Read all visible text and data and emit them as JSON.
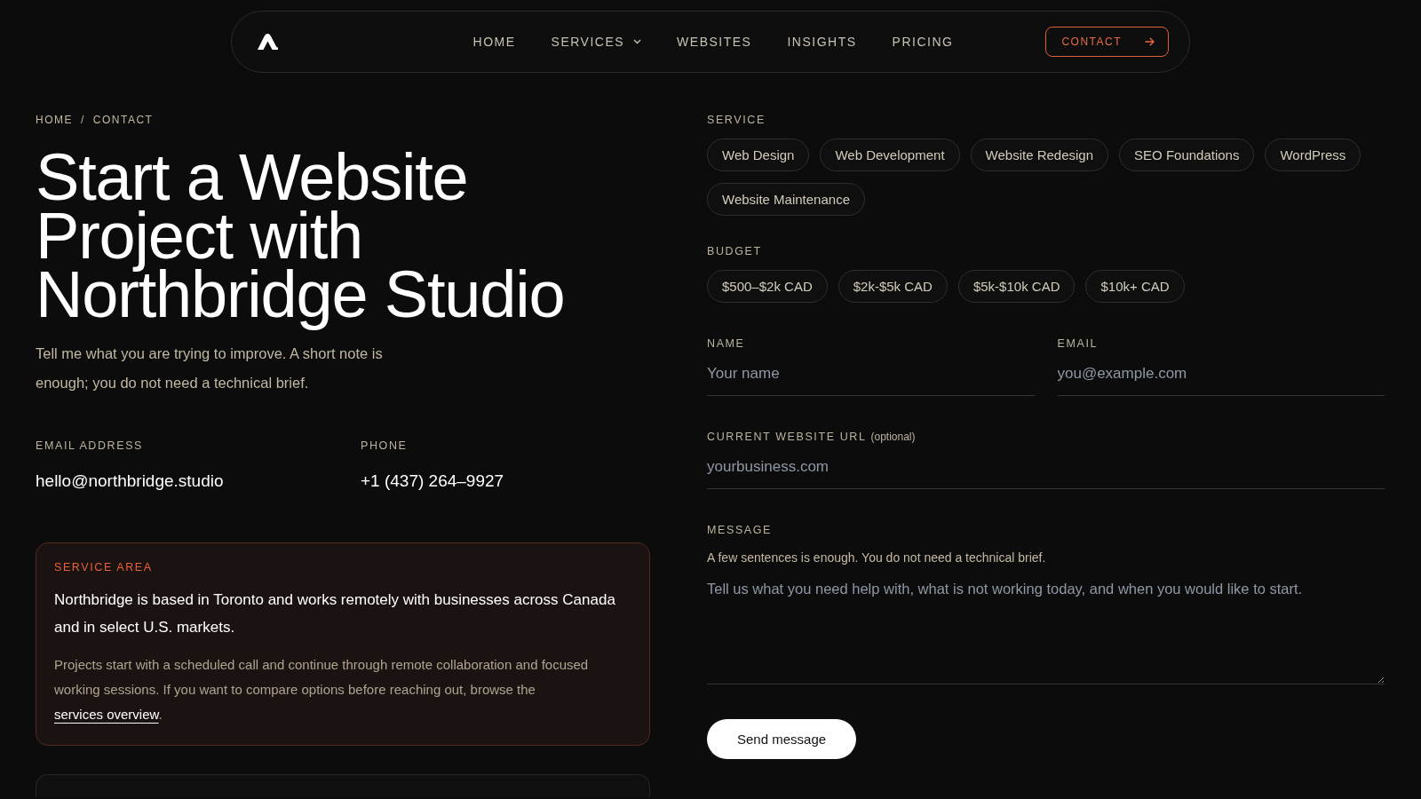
{
  "nav": {
    "links": [
      {
        "label": "HOME",
        "selected": false,
        "has_menu": false
      },
      {
        "label": "SERVICES",
        "selected": false,
        "has_menu": true
      },
      {
        "label": "WEBSITES",
        "selected": false,
        "has_menu": false
      },
      {
        "label": "INSIGHTS",
        "selected": false,
        "has_menu": false
      },
      {
        "label": "PRICING",
        "selected": false,
        "has_menu": false
      }
    ],
    "cta": "CONTACT"
  },
  "breadcrumb": {
    "items": [
      "HOME",
      "CONTACT"
    ],
    "separator": "/"
  },
  "hero": {
    "title": "Start a Website Project with Northbridge Studio",
    "intro": "Tell me what you are trying to improve. A short note is enough; you do not need a technical brief."
  },
  "contacts": [
    {
      "label": "EMAIL ADDRESS",
      "value": "hello@northbridge.studio"
    },
    {
      "label": "PHONE",
      "value": "+1 (437) 264–9927"
    }
  ],
  "cards": [
    {
      "kind": "highlight",
      "label": "SERVICE AREA",
      "lead": "Northbridge is based in Toronto and works remotely with businesses across Canada and in select U.S. markets.",
      "body": "Projects start with a scheduled call and continue through remote collaboration and focused working sessions. If you want to compare options before reaching out, browse the ",
      "link": "services overview",
      "after": "."
    },
    {
      "kind": "plain"
    }
  ],
  "form": {
    "groups": [
      {
        "label": "SERVICE",
        "options": [
          {
            "label": "Web Design",
            "selected": false
          },
          {
            "label": "Web Development",
            "selected": false
          },
          {
            "label": "Website Redesign",
            "selected": false
          },
          {
            "label": "SEO Foundations",
            "selected": false
          },
          {
            "label": "WordPress",
            "selected": false
          },
          {
            "label": "Website Maintenance",
            "selected": false
          }
        ]
      },
      {
        "label": "BUDGET",
        "options": [
          {
            "label": "$500–$2k CAD",
            "selected": false
          },
          {
            "label": "$2k-$5k CAD",
            "selected": false
          },
          {
            "label": "$5k-$10k CAD",
            "selected": false
          },
          {
            "label": "$10k+ CAD",
            "selected": false
          }
        ]
      }
    ],
    "rows": [
      [
        {
          "kind": "input",
          "label": "NAME",
          "placeholder": "Your name"
        },
        {
          "kind": "input",
          "label": "EMAIL",
          "placeholder": "you@example.com"
        }
      ],
      [
        {
          "kind": "input",
          "label": "CURRENT WEBSITE URL",
          "note": "(optional)",
          "placeholder": "yourbusiness.com"
        }
      ],
      [
        {
          "kind": "textarea",
          "label": "MESSAGE",
          "hint": "A few sentences is enough. You do not need a technical brief.",
          "placeholder": "Tell us what you need help with, what is not working today, and when you would like to start."
        }
      ]
    ],
    "submit": "Send message"
  }
}
